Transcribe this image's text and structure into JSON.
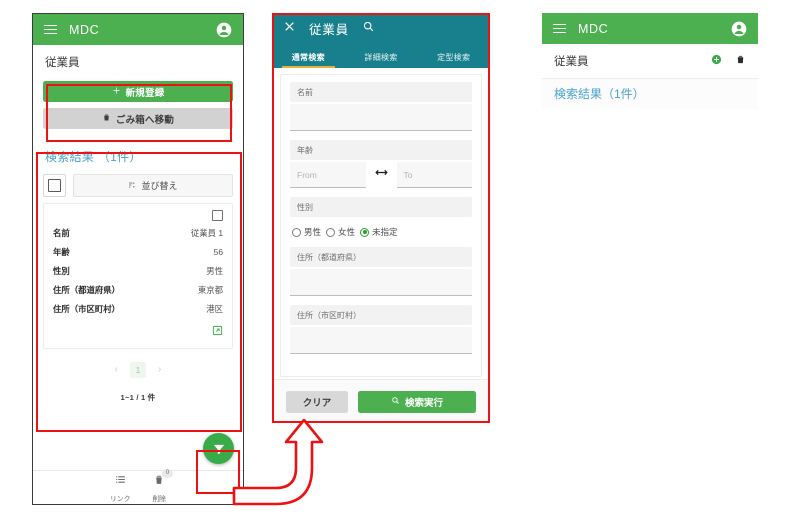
{
  "app": {
    "brand": "MDC",
    "menu_icon": "hamburger-icon",
    "account_icon": "account-circle-icon"
  },
  "phone1": {
    "page_title": "従業員",
    "actions": {
      "new_label": "新規登録",
      "new_icon": "plus-icon",
      "trash_label": "ごみ箱へ移動",
      "trash_icon": "trash-icon"
    },
    "results": {
      "heading": "検索結果 （1件）",
      "select_all_icon": "checkbox-unchecked-icon",
      "sort_label": "並び替え",
      "sort_icon": "sort-icon",
      "card": {
        "row_checkbox_icon": "checkbox-unchecked-icon",
        "open_icon": "open-in-new-icon",
        "rows": [
          {
            "key": "名前",
            "value": "従業員 1"
          },
          {
            "key": "年齢",
            "value": "56"
          },
          {
            "key": "性別",
            "value": "男性"
          },
          {
            "key": "住所（都道府県）",
            "value": "東京都"
          },
          {
            "key": "住所（市区町村）",
            "value": "港区"
          }
        ]
      },
      "pagination": {
        "prev_icon": "chevron-left-icon",
        "page": "1",
        "next_icon": "chevron-right-icon",
        "count_text": "1~1 / 1 件"
      }
    },
    "bottom_nav": [
      {
        "label": "リンク",
        "icon": "link-list-icon",
        "badge": ""
      },
      {
        "label": "削除",
        "icon": "delete-icon",
        "badge": "0"
      }
    ],
    "fab": {
      "icon": "filter-icon",
      "color": "#3aab49"
    }
  },
  "phone2": {
    "close_icon": "close-icon",
    "title": "従業員",
    "search_icon": "search-icon",
    "header_color": "#18808c",
    "tabs": [
      {
        "label": "通常検索",
        "active": true
      },
      {
        "label": "詳細検索",
        "active": false
      },
      {
        "label": "定型検索",
        "active": false
      }
    ],
    "fields": {
      "name_label": "名前",
      "name_value": "",
      "age_label": "年齢",
      "age_from_placeholder": "From",
      "age_to_placeholder": "To",
      "range_icon": "arrows-horizontal-icon",
      "gender_label": "性別",
      "gender_options": [
        {
          "label": "男性",
          "selected": false
        },
        {
          "label": "女性",
          "selected": false
        },
        {
          "label": "未指定",
          "selected": true
        }
      ],
      "pref_label": "住所（都道府県）",
      "pref_value": "",
      "city_label": "住所（市区町村）",
      "city_value": ""
    },
    "footer": {
      "clear_label": "クリア",
      "search_label": "検索実行",
      "search_icon": "search-icon"
    }
  },
  "phone3": {
    "page_title": "従業員",
    "add_icon": "add-circle-icon",
    "delete_icon": "trash-icon",
    "result_heading": "検索結果（1件）"
  },
  "annotation": {
    "highlight_color": "#ee1111",
    "arrow_icon": "curved-up-arrow"
  }
}
